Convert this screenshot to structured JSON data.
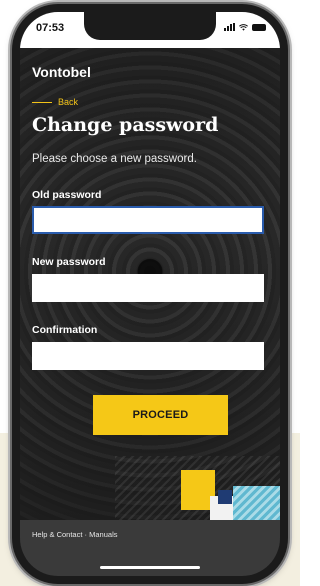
{
  "status_bar": {
    "time": "07:53"
  },
  "app": {
    "brand": "Vontobel"
  },
  "nav": {
    "back_label": "Back"
  },
  "page": {
    "title": "Change password",
    "subtitle": "Please choose a new password."
  },
  "form": {
    "old_password": {
      "label": "Old password",
      "value": ""
    },
    "new_password": {
      "label": "New password",
      "value": ""
    },
    "confirmation": {
      "label": "Confirmation",
      "value": ""
    },
    "submit_label": "PROCEED"
  },
  "footer": {
    "help_label": "Help & Contact",
    "separator": "·",
    "manuals_label": "Manuals"
  },
  "colors": {
    "accent": "#f5c817",
    "focus_border": "#2a5cad",
    "background": "#2e2e2e",
    "page_bg_band": "#f3efe0"
  },
  "icons": [
    "signal-icon",
    "wifi-icon",
    "battery-icon"
  ]
}
